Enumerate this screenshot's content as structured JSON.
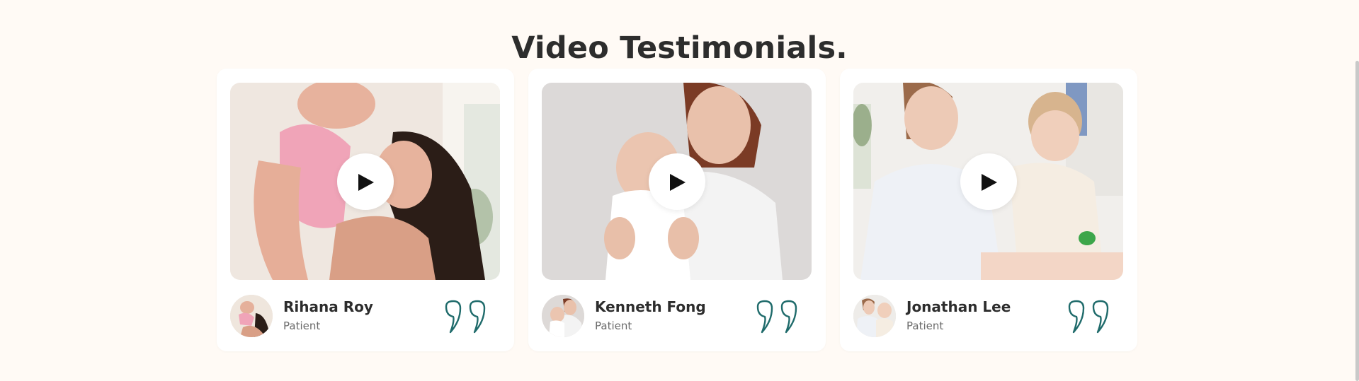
{
  "section": {
    "title": "Video Testimonials."
  },
  "testimonials": [
    {
      "name": "Rihana Roy",
      "role": "Patient",
      "icon": "play-icon"
    },
    {
      "name": "Kenneth Fong",
      "role": "Patient",
      "icon": "play-icon"
    },
    {
      "name": "Jonathan Lee",
      "role": "Patient",
      "icon": "play-icon"
    }
  ],
  "colors": {
    "background": "#fffaf5",
    "card": "#ffffff",
    "heading": "#2d2d2d",
    "quote_accent": "#1f6b6b"
  }
}
